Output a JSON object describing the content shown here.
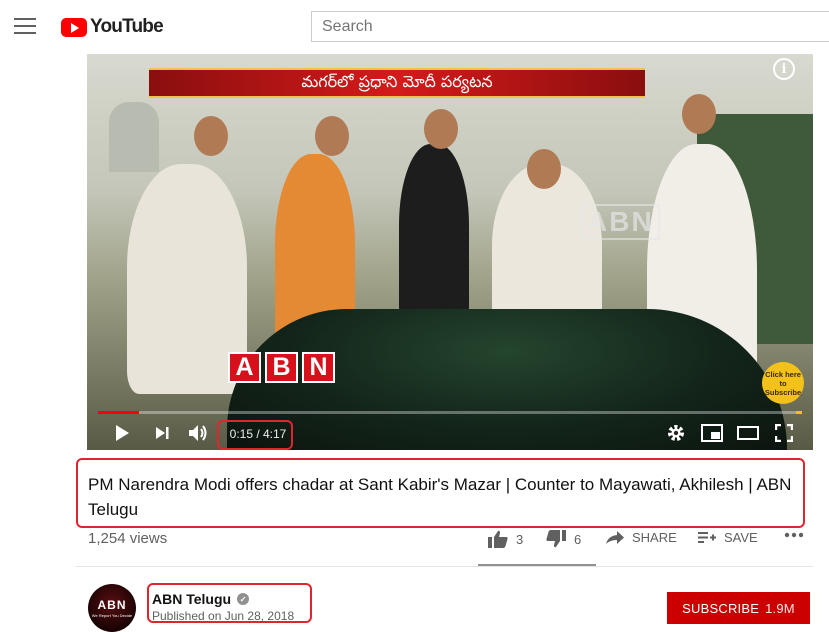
{
  "header": {
    "logo_text": "YouTube",
    "search_placeholder": "Search"
  },
  "player": {
    "banner_text": "మగర్‌లో ప్రధాని మోదీ పర్యటన",
    "watermark": "ABN",
    "logo_letters": [
      "A",
      "B",
      "N"
    ],
    "click_subscribe": "Click here to Subscribe",
    "current_time": "0:15",
    "duration": "4:17",
    "time_display": "0:15 / 4:17",
    "progress_fraction": 0.058
  },
  "video": {
    "title": "PM Narendra Modi offers chadar at Sant Kabir's Mazar | Counter to Mayawati, Akhilesh | ABN Telugu",
    "views": "1,254 views",
    "likes": "3",
    "dislikes": "6",
    "share_label": "SHARE",
    "save_label": "SAVE"
  },
  "channel": {
    "avatar_text": "ABN",
    "avatar_tagline": "We Report You Decide",
    "name": "ABN Telugu",
    "published": "Published on Jun 28, 2018",
    "subscribe_label": "SUBSCRIBE",
    "subscriber_count": "1.9M"
  },
  "colors": {
    "brand_red": "#ff0000",
    "subscribe_red": "#cc0000",
    "highlight_box": "#e0252f"
  }
}
